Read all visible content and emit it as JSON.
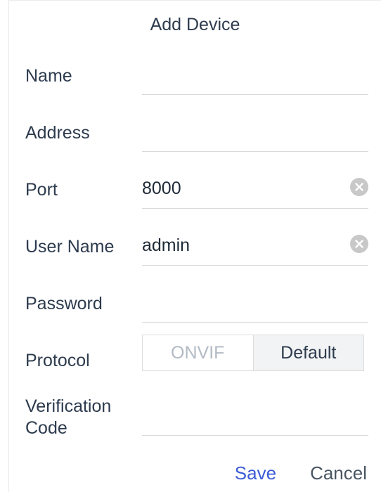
{
  "dialog": {
    "title": "Add Device",
    "fields": {
      "name": {
        "label": "Name",
        "value": ""
      },
      "address": {
        "label": "Address",
        "value": ""
      },
      "port": {
        "label": "Port",
        "value": "8000"
      },
      "user_name": {
        "label": "User Name",
        "value": "admin"
      },
      "password": {
        "label": "Password",
        "value": ""
      },
      "protocol": {
        "label": "Protocol",
        "options": [
          "ONVIF",
          "Default"
        ],
        "selected": "Default"
      },
      "verification_code": {
        "label_line1": "Verification",
        "label_line2": "Code",
        "value": ""
      }
    },
    "actions": {
      "save_label": "Save",
      "cancel_label": "Cancel"
    }
  },
  "colors": {
    "text": "#2d3b4e",
    "accent": "#3d5bd6",
    "disabled": "#b2bac4",
    "underline": "#d9d9d9",
    "clear_icon": "#c8c8c8"
  },
  "icons": [
    "clear-icon"
  ]
}
